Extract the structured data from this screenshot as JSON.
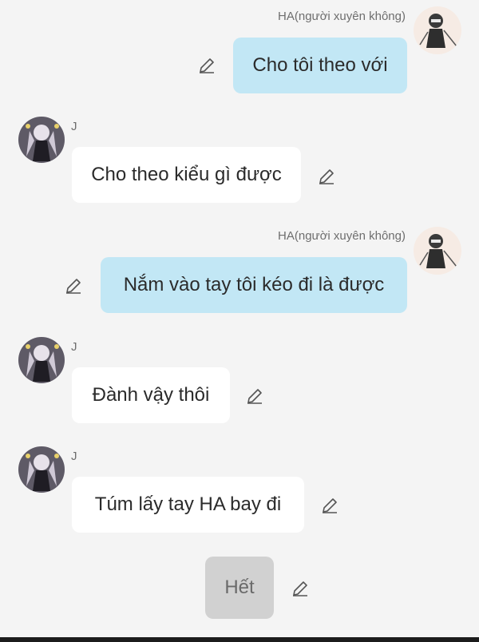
{
  "messages": [
    {
      "sender": "HA(người xuyên không)",
      "side": "right",
      "avatar_icon": "ha-character-avatar",
      "text": "Cho tôi theo với"
    },
    {
      "sender": "J",
      "side": "left",
      "avatar_icon": "j-character-avatar",
      "text": "Cho theo kiểu gì được"
    },
    {
      "sender": "HA(người xuyên không)",
      "side": "right",
      "avatar_icon": "ha-character-avatar",
      "text": "Nắm vào tay tôi kéo đi là được"
    },
    {
      "sender": "J",
      "side": "left",
      "avatar_icon": "j-character-avatar",
      "text": "Đành vậy thôi"
    },
    {
      "sender": "J",
      "side": "left",
      "avatar_icon": "j-character-avatar",
      "text": "Túm lấy tay HA bay đi"
    },
    {
      "sender": "",
      "side": "center",
      "avatar_icon": "",
      "text": "Hết"
    }
  ],
  "icons": {
    "edit": "pencil-edit-icon"
  },
  "colors": {
    "background": "#f4f4f4",
    "my_bubble": "#c2e7f5",
    "their_bubble": "#ffffff",
    "narration_bubble": "#d1d1d1"
  }
}
